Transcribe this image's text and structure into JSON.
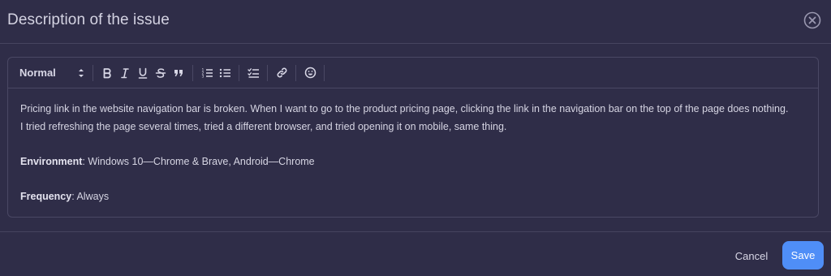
{
  "modal": {
    "title": "Description of the issue",
    "close_icon": "close-circle-icon"
  },
  "toolbar": {
    "format_value": "Normal",
    "buttons": [
      {
        "icon": "bold-icon"
      },
      {
        "icon": "italic-icon"
      },
      {
        "icon": "underline-icon"
      },
      {
        "icon": "strikethrough-icon"
      },
      {
        "icon": "quote-icon"
      },
      {
        "icon": "ordered-list-icon"
      },
      {
        "icon": "bullet-list-icon"
      },
      {
        "icon": "checklist-icon"
      },
      {
        "icon": "link-icon"
      },
      {
        "icon": "emoji-icon"
      }
    ]
  },
  "editor": {
    "paragraph1_line1": "Pricing link in the website navigation bar is broken.  When I want to go to the product pricing page, clicking the link in the navigation bar on the top of the page does nothing.",
    "paragraph1_line2": "I tried refreshing the page several times, tried a different browser, and tried opening it on mobile, same thing.",
    "environment_label": "Environment",
    "environment_value": ": Windows 10—Chrome & Brave, Android—Chrome",
    "frequency_label": "Frequency",
    "frequency_value": ": Always"
  },
  "footer": {
    "cancel_label": "Cancel",
    "save_label": "Save"
  },
  "colors": {
    "background": "#2f2d48",
    "border": "#4a4864",
    "accent": "#4f8ef7"
  }
}
